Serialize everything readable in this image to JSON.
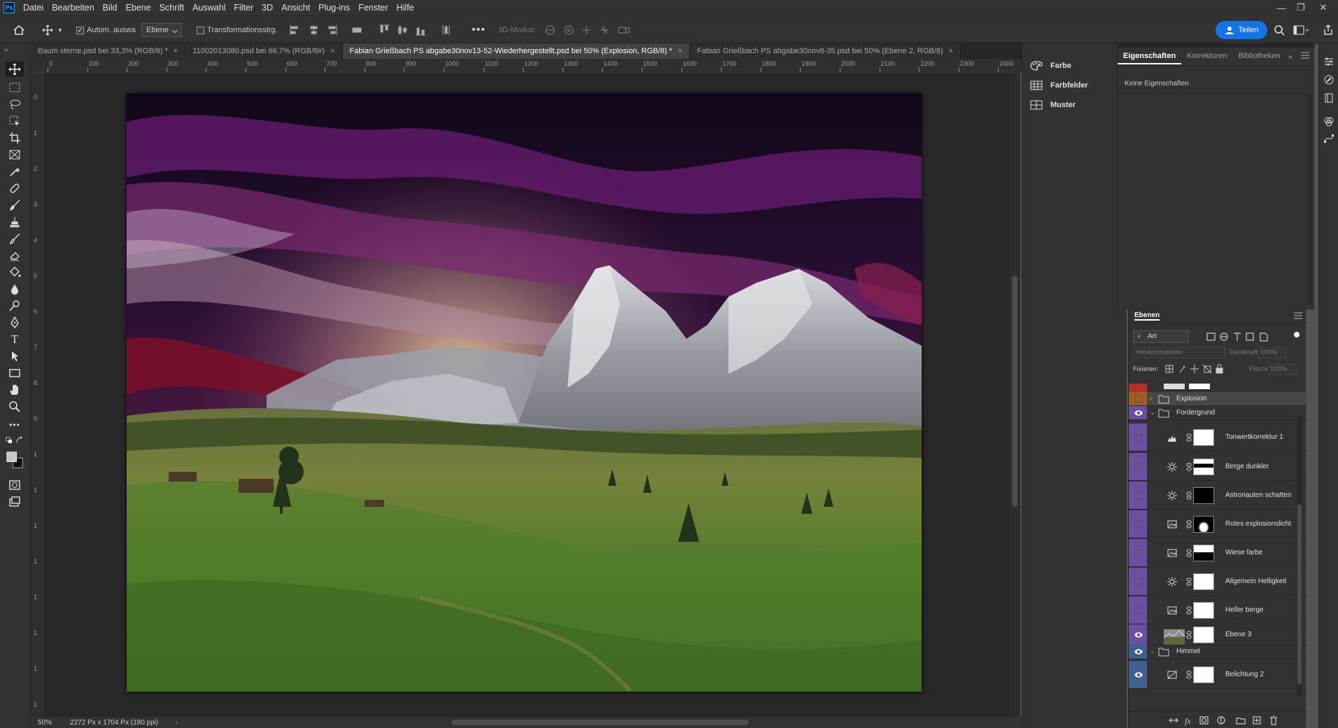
{
  "app": {
    "logo": "Ps"
  },
  "menu": [
    "Datei",
    "Bearbeiten",
    "Bild",
    "Ebene",
    "Schrift",
    "Auswahl",
    "Filter",
    "3D",
    "Ansicht",
    "Plug-ins",
    "Fenster",
    "Hilfe"
  ],
  "options": {
    "auto_select_label": "Autom. auswa",
    "auto_select_target": "Ebene",
    "transform_label": "Transformationsstrg.",
    "three_d_label": "3D-Modus:",
    "share_label": "Teilen"
  },
  "tabs": [
    {
      "label": "Baum sterne.psd bei 33,3% (RGB/8) *"
    },
    {
      "label": "11002013080.psd bei 66,7% (RGB/8#)"
    },
    {
      "label": "Fabian Grießbach PS abgabe30nov13-52-Wiederhergestellt.psd bei 50% (Explosion, RGB/8) *"
    },
    {
      "label": "Fabian Grießbach PS abgabe30nov8-35.psd bei 50% (Ebene 2, RGB/8)"
    }
  ],
  "ruler": {
    "h": [
      "0",
      "100",
      "200",
      "300",
      "400",
      "500",
      "600",
      "700",
      "800",
      "900",
      "1000",
      "1100",
      "1200",
      "1300",
      "1400",
      "1500",
      "1600",
      "1700",
      "1800",
      "1900",
      "2000",
      "2100",
      "2200",
      "2300",
      "2400",
      "25"
    ],
    "v": [
      "0",
      "1",
      "2",
      "3",
      "4",
      "5",
      "6",
      "7",
      "8",
      "9",
      "1",
      "1",
      "1",
      "1",
      "1",
      "1",
      "1",
      "1"
    ]
  },
  "status": {
    "zoom": "50%",
    "doc_info": "2272 Px x 1704 Px (180 ppi)"
  },
  "mid_panel": {
    "items": [
      "Farbe",
      "Farbfelder",
      "Muster"
    ]
  },
  "properties": {
    "tabs": [
      "Eigenschaften",
      "Korrekturen",
      "Bibliotheken"
    ],
    "content": "Keine Eigenschaften"
  },
  "layers": {
    "title": "Ebenen",
    "filter_kind": "Art",
    "blend_mode": "Hindurchwirken",
    "opacity_label": "Deckkraft:",
    "opacity_value": "100%",
    "lock_label": "Fixieren:",
    "fill_label": "Fläche:",
    "fill_value": "100%",
    "rows": [
      {
        "name": "Explosion",
        "kind": "group",
        "visible": false,
        "color": "#a35d1c",
        "indent": 0,
        "collapsed": true
      },
      {
        "name": "Fordergrund",
        "kind": "group",
        "visible": true,
        "color": "#6a4fa3",
        "indent": 0,
        "collapsed": false
      },
      {
        "name": "Tonwertkorrektur 1",
        "kind": "levels",
        "visible": false,
        "color": "#6a4fa3",
        "indent": 1
      },
      {
        "name": "Berge dunkler",
        "kind": "brightness",
        "visible": false,
        "color": "#6a4fa3",
        "indent": 1
      },
      {
        "name": "Astronauten schatten",
        "kind": "brightness",
        "visible": false,
        "color": "#6a4fa3",
        "indent": 1
      },
      {
        "name": "Rotes explosionslicht",
        "kind": "photo",
        "visible": false,
        "color": "#6a4fa3",
        "indent": 1
      },
      {
        "name": "Wiese farbe",
        "kind": "photo",
        "visible": false,
        "color": "#6a4fa3",
        "indent": 1
      },
      {
        "name": "Allgemein Helligkeit",
        "kind": "brightness",
        "visible": false,
        "color": "#6a4fa3",
        "indent": 1
      },
      {
        "name": "Heller berge",
        "kind": "photo",
        "visible": false,
        "color": "#6a4fa3",
        "indent": 1
      },
      {
        "name": "Ebene 3",
        "kind": "pixel",
        "visible": true,
        "color": "#6a4fa3",
        "indent": 1
      },
      {
        "name": "Himmel",
        "kind": "group",
        "visible": true,
        "color": "#3e5f8f",
        "indent": 0,
        "collapsed": false
      },
      {
        "name": "Belichtung 2",
        "kind": "exposure",
        "visible": true,
        "color": "#3e5f8f",
        "indent": 1
      }
    ]
  },
  "colors": {
    "accent": "#1473e6",
    "panel": "#323232",
    "canvas_bg": "#282828"
  }
}
